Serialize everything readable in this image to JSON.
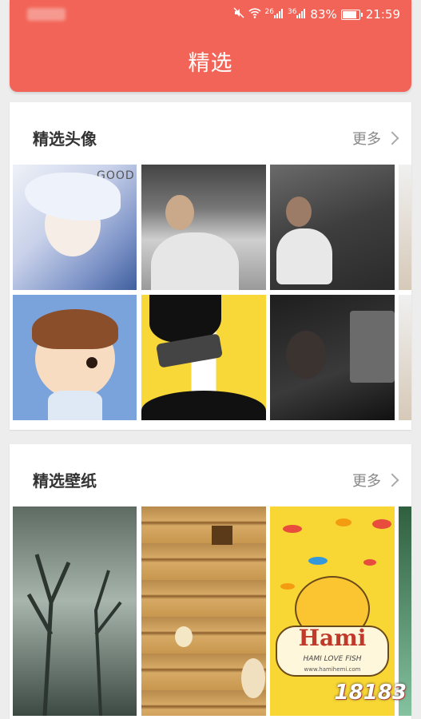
{
  "status_bar": {
    "signal_a": "26",
    "signal_b": "36",
    "battery": "83%",
    "time": "21:59"
  },
  "header": {
    "title": "精选"
  },
  "sections": {
    "avatars": {
      "title": "精选头像",
      "more": "更多"
    },
    "wallpapers": {
      "title": "精选壁纸",
      "more": "更多"
    }
  },
  "images": {
    "avatar_1_text": "GOOD",
    "hami_title": "Hami",
    "hami_subtitle": "HAMI LOVE FISH",
    "hami_url": "www.hamihemi.com"
  },
  "watermark": "18183",
  "colors": {
    "accent": "#f26457",
    "background": "#ededed"
  },
  "icons": [
    "mute-icon",
    "wifi-icon",
    "signal-icon",
    "battery-icon",
    "chevron-right-icon"
  ]
}
